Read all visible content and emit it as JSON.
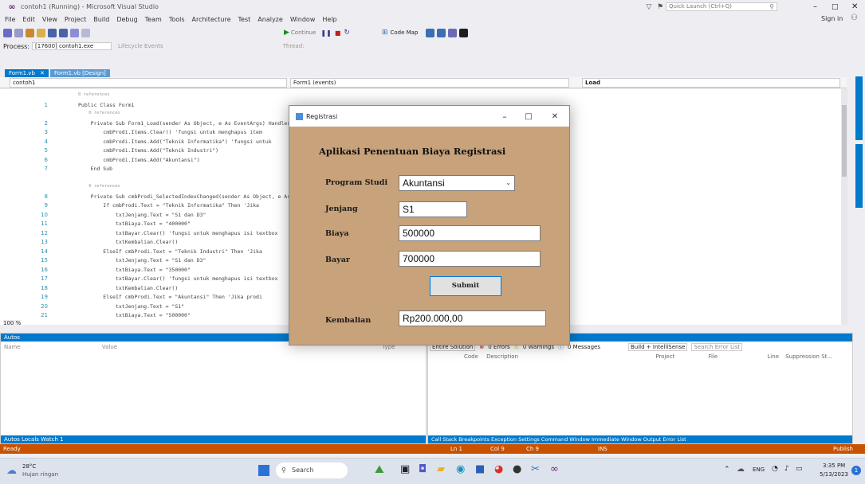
{
  "window": {
    "title": "contoh1 (Running) - Microsoft Visual Studio",
    "search_placeholder": "Quick Launch (Ctrl+Q)",
    "signin": "Sign in"
  },
  "menu": [
    "File",
    "Edit",
    "View",
    "Project",
    "Build",
    "Debug",
    "Team",
    "Tools",
    "Architecture",
    "Test",
    "Analyze",
    "Window",
    "Help"
  ],
  "toolbar": {
    "process_label": "Process:",
    "process_value": "[17600] contoh1.exe",
    "lifecycle": "Lifecycle Events",
    "thread": "Thread:",
    "continue_label": "Continue",
    "code_map": "Code Map"
  },
  "tabs": [
    {
      "label": "Form1.vb",
      "active": true
    },
    {
      "label": "Form1.vb [Design]",
      "active": false
    }
  ],
  "codebar": {
    "project": "contoh1",
    "object": "Form1 (events)",
    "event": "Load"
  },
  "editor": {
    "zoom": "100 %",
    "lines": [
      {
        "n": "",
        "text": "0 references"
      },
      {
        "n": "1",
        "text": "Public Class Form1"
      },
      {
        "n": "",
        "text": "    0 references"
      },
      {
        "n": "2",
        "text": "    Private Sub Form1_Load(sender As Object, e As EventArgs) Handles MyBase.Load"
      },
      {
        "n": "3",
        "text": "        cmbProdi.Items.Clear() 'fungsi untuk menghapus item"
      },
      {
        "n": "4",
        "text": "        cmbProdi.Items.Add(\"Teknik Informatika\") 'fungsi untuk"
      },
      {
        "n": "5",
        "text": "        cmbProdi.Items.Add(\"Teknik Industri\")"
      },
      {
        "n": "6",
        "text": "        cmbProdi.Items.Add(\"Akuntansi\")"
      },
      {
        "n": "7",
        "text": "    End Sub"
      },
      {
        "n": "",
        "text": ""
      },
      {
        "n": "",
        "text": "    0 references"
      },
      {
        "n": "8",
        "text": "    Private Sub cmbProdi_SelectedIndexChanged(sender As Object, e As EventArgs)"
      },
      {
        "n": "9",
        "text": "        If cmbProdi.Text = \"Teknik Informatika\" Then 'Jika"
      },
      {
        "n": "10",
        "text": "            txtJenjang.Text = \"S1 dan D3\""
      },
      {
        "n": "11",
        "text": "            txtBiaya.Text = \"400000\""
      },
      {
        "n": "12",
        "text": "            txtBayar.Clear() 'fungsi untuk menghapus isi textbox"
      },
      {
        "n": "13",
        "text": "            txtKembalian.Clear()"
      },
      {
        "n": "14",
        "text": "        ElseIf cmbProdi.Text = \"Teknik Industri\" Then 'Jika"
      },
      {
        "n": "15",
        "text": "            txtJenjang.Text = \"S1 dan D3\""
      },
      {
        "n": "16",
        "text": "            txtBiaya.Text = \"350000\""
      },
      {
        "n": "17",
        "text": "            txtBayar.Clear() 'fungsi untuk menghapus isi textbox"
      },
      {
        "n": "18",
        "text": "            txtKembalian.Clear()"
      },
      {
        "n": "19",
        "text": "        ElseIf cmbProdi.Text = \"Akuntansi\" Then 'Jika prodi"
      },
      {
        "n": "20",
        "text": "            txtJenjang.Text = \"S1\""
      },
      {
        "n": "21",
        "text": "            txtBiaya.Text = \"500000\""
      }
    ]
  },
  "autos": {
    "title": "Autos",
    "col_name": "Name",
    "col_value": "Value",
    "col_type": "Type",
    "tabs": "Autos  Locals  Watch 1"
  },
  "errors": {
    "title": "Error List",
    "scope": "Entire Solution",
    "errors": "0 Errors",
    "warnings": "0 Warnings",
    "messages": "0 Messages",
    "build": "Build + IntelliSense",
    "search": "Search Error List",
    "col_code": "Code",
    "col_desc": "Description",
    "col_project": "Project",
    "col_file": "File",
    "col_line": "Line",
    "col_supp": "Suppression St...",
    "tabs": "Call Stack  Breakpoints  Exception Settings  Command Window  Immediate Window  Output  Error List"
  },
  "status": {
    "text": "Ready",
    "ln": "Ln 1",
    "col": "Col 9",
    "ch": "Ch 9",
    "ins": "INS",
    "publish": "Publish"
  },
  "taskbar": {
    "weather_temp": "28°C",
    "weather_desc": "Hujan ringan",
    "search": "Search",
    "lang": "ENG",
    "time": "3:35 PM",
    "date": "5/13/2023",
    "badge": "1"
  },
  "dialog": {
    "title": "Registrasi",
    "heading": "Aplikasi Penentuan Biaya Registrasi",
    "prodi_label": "Program Studi",
    "prodi_value": "Akuntansi",
    "jenjang_label": "Jenjang",
    "jenjang_value": "S1",
    "biaya_label": "Biaya",
    "biaya_value": "500000",
    "bayar_label": "Bayar",
    "bayar_value": "700000",
    "submit_label": "Submit",
    "kembalian_label": "Kembalian",
    "kembalian_value": "Rp200.000,00"
  }
}
